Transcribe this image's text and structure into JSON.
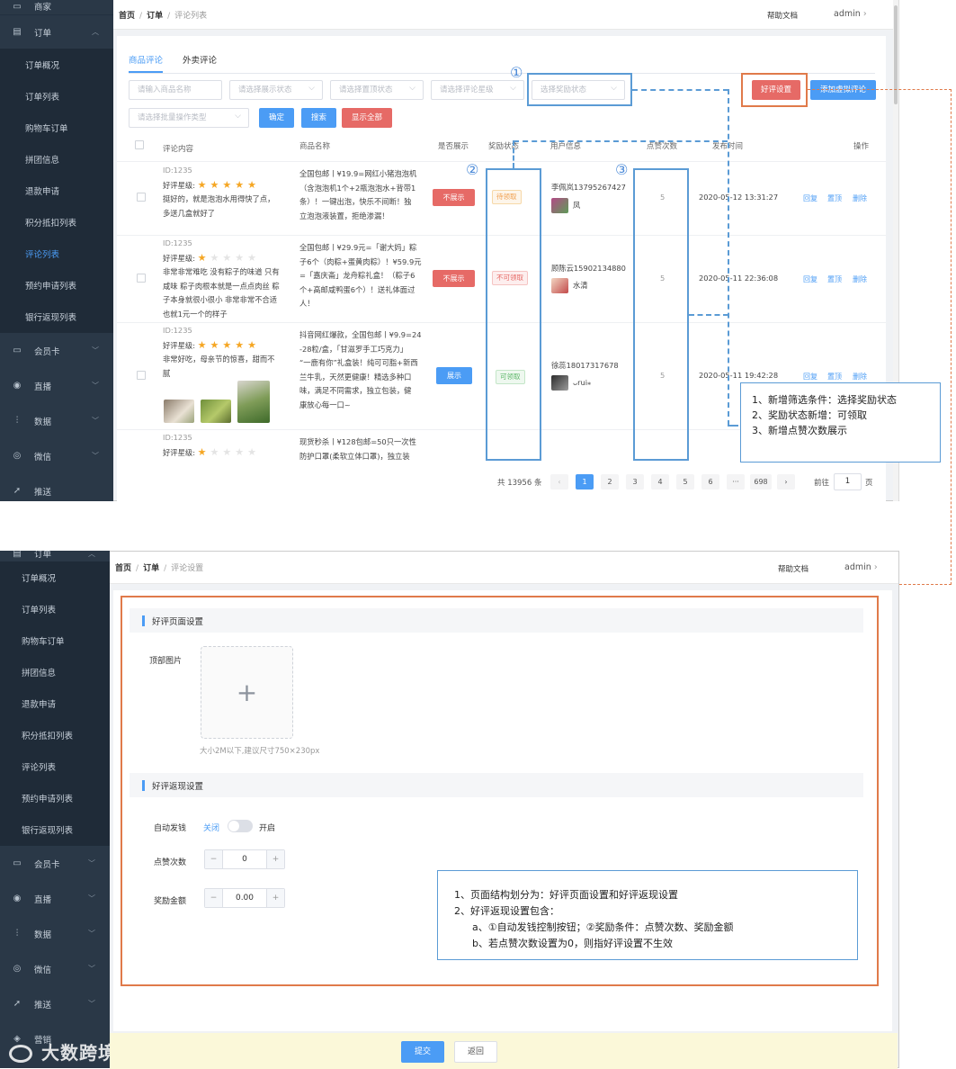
{
  "top": {
    "sidebar": {
      "items": [
        {
          "icon": "store-icon",
          "label": "商家",
          "type": "top"
        },
        {
          "icon": "order-icon",
          "label": "订单",
          "type": "top",
          "expanded": true
        },
        {
          "label": "订单概况",
          "type": "child"
        },
        {
          "label": "订单列表",
          "type": "child"
        },
        {
          "label": "购物车订单",
          "type": "child"
        },
        {
          "label": "拼团信息",
          "type": "child"
        },
        {
          "label": "退款申请",
          "type": "child"
        },
        {
          "label": "积分抵扣列表",
          "type": "child"
        },
        {
          "label": "评论列表",
          "type": "child",
          "active": true
        },
        {
          "label": "预约申请列表",
          "type": "child"
        },
        {
          "label": "银行返现列表",
          "type": "child"
        },
        {
          "icon": "card-icon",
          "label": "会员卡",
          "type": "top"
        },
        {
          "icon": "live-icon",
          "label": "直播",
          "type": "top"
        },
        {
          "icon": "data-icon",
          "label": "数据",
          "type": "top"
        },
        {
          "icon": "wechat-icon",
          "label": "微信",
          "type": "top"
        },
        {
          "icon": "push-icon",
          "label": "推送",
          "type": "top"
        }
      ]
    },
    "breadcrumb": {
      "home": "首页",
      "section": "订单",
      "current": "评论列表"
    },
    "help": "帮助文档",
    "admin": "admin",
    "tabs": [
      "商品评论",
      "外卖评论"
    ],
    "filters": {
      "product_name": "请输入商品名称",
      "display_status": "请选择展示状态",
      "top_status": "请选择置顶状态",
      "rating": "请选择评论星级",
      "reward_status": "选择奖励状态",
      "batch_type": "请选择批量操作类型"
    },
    "buttons": {
      "confirm": "确定",
      "search": "搜索",
      "show_all": "显示全部",
      "good_review_settings": "好评设置",
      "add_fake_review": "添加虚拟评论"
    },
    "table": {
      "headers": [
        "评论内容",
        "商品名称",
        "是否展示",
        "奖励状态",
        "用户信息",
        "点赞次数",
        "发布时间",
        "操作"
      ],
      "rows": [
        {
          "id": "ID:1235",
          "rating_label": "好评星级:",
          "stars": 5,
          "comment": [
            "挺好的，就是泡泡水用得快了点，",
            "多送几盒就好了"
          ],
          "product": [
            "全国包邮丨¥19.9=网红小猪泡泡机",
            "（含泡泡机1个+2瓶泡泡水+背带1",
            "条）！一键出泡，快乐不间断！独",
            "立泡泡液装置，拒绝渗漏！"
          ],
          "display_btn": "不展示",
          "reward": "待领取",
          "user_name": "李佩岚13795267427",
          "nickname": "凤",
          "likes": "5",
          "time": "2020-05-12 13:31:27",
          "actions": [
            "回复",
            "置顶",
            "删除"
          ]
        },
        {
          "id": "ID:1235",
          "rating_label": "好评星级:",
          "stars": 1,
          "comment": [
            "非常非常难吃 没有粽子的味道 只有",
            "咸味 粽子肉根本就是一点点肉丝 粽",
            "子本身就很小很小 非常非常不合适",
            "也就1元一个的样子"
          ],
          "product": [
            "全国包邮丨¥29.9元=「谢大妈」粽",
            "子6个（肉粽+蛋黄肉粽）！¥59.9元",
            "=「嘉庆斋」龙舟粽礼盒！（粽子6",
            "个+高邮咸鸭蛋6个）！送礼体面过",
            "人！"
          ],
          "display_btn": "不展示",
          "reward": "不可领取",
          "user_name": "顾陈云15902134880",
          "nickname": "水清",
          "likes": "5",
          "time": "2020-05-11 22:36:08",
          "actions": [
            "回复",
            "置顶",
            "删除"
          ]
        },
        {
          "id": "ID:1235",
          "rating_label": "好评星级:",
          "stars": 5,
          "comment": [
            "非常好吃，母亲节的惊喜，甜而不",
            "腻"
          ],
          "product": [
            "抖音网红爆款，全国包邮丨¥9.9=24",
            "-28粒/盒，「甘滋罗手工巧克力」",
            "“一鹿有你”礼盒装！纯可可脂+新西",
            "兰牛乳，天然更健康！精选多种口",
            "味，满足不同需求，独立包装，健",
            "康放心每一口~"
          ],
          "display_btn": "展示",
          "reward": "可领取",
          "user_name": "徐蕊18017317678",
          "nickname": "ᴗrui⁎",
          "likes": "5",
          "time": "2020-05-11 19:42:28",
          "actions": [
            "回复",
            "置顶",
            "删除"
          ]
        },
        {
          "id": "ID:1235",
          "rating_label": "好评星级:",
          "stars": 1,
          "comment": [],
          "product": [
            "现货秒杀丨¥128包邮=50只一次性",
            "防护口罩(柔软立体口罩)，独立装"
          ],
          "display_btn": "",
          "reward": "",
          "user_name": "",
          "nickname": "",
          "likes": "",
          "time": "",
          "actions": []
        }
      ]
    },
    "pagination": {
      "total": "共 13956 条",
      "pages": [
        "1",
        "2",
        "3",
        "4",
        "5",
        "6",
        "···",
        "698"
      ],
      "goto_label": "前往",
      "goto_value": "1",
      "page_unit": "页"
    },
    "annotations": {
      "markers": [
        "①",
        "②",
        "③"
      ],
      "note": [
        "1、新增筛选条件：选择奖励状态",
        "2、奖励状态新增：可领取",
        "3、新增点赞次数展示"
      ]
    }
  },
  "bottom": {
    "sidebar": {
      "items": [
        {
          "icon": "order-icon",
          "label": "订单",
          "type": "top",
          "expanded": true
        },
        {
          "label": "订单概况",
          "type": "child"
        },
        {
          "label": "订单列表",
          "type": "child"
        },
        {
          "label": "购物车订单",
          "type": "child"
        },
        {
          "label": "拼团信息",
          "type": "child"
        },
        {
          "label": "退款申请",
          "type": "child"
        },
        {
          "label": "积分抵扣列表",
          "type": "child"
        },
        {
          "label": "评论列表",
          "type": "child"
        },
        {
          "label": "预约申请列表",
          "type": "child"
        },
        {
          "label": "银行返现列表",
          "type": "child"
        },
        {
          "icon": "card-icon",
          "label": "会员卡",
          "type": "top"
        },
        {
          "icon": "live-icon",
          "label": "直播",
          "type": "top"
        },
        {
          "icon": "data-icon",
          "label": "数据",
          "type": "top"
        },
        {
          "icon": "wechat-icon",
          "label": "微信",
          "type": "top"
        },
        {
          "icon": "push-icon",
          "label": "推送",
          "type": "top"
        },
        {
          "icon": "marketing-icon",
          "label": "营销",
          "type": "top"
        }
      ]
    },
    "breadcrumb": {
      "home": "首页",
      "section": "订单",
      "current": "评论设置"
    },
    "help": "帮助文档",
    "admin": "admin",
    "section1": {
      "title": "好评页面设置",
      "top_image_label": "顶部图片",
      "upload_hint": "大小2M以下,建议尺寸750×230px"
    },
    "section2": {
      "title": "好评返现设置",
      "auto_pay_label": "自动发钱",
      "off_label": "关闭",
      "on_label": "开启",
      "likes_label": "点赞次数",
      "likes_value": "0",
      "amount_label": "奖励金额",
      "amount_value": "0.00"
    },
    "buttons": {
      "submit": "提交",
      "back": "返回"
    },
    "note": [
      "1、页面结构划分为：好评页面设置和好评返现设置",
      "2、好评返现设置包含：",
      "a、①自动发钱控制按钮；②奖励条件：点赞次数、奖励金额",
      "b、若点赞次数设置为0，则指好评设置不生效"
    ],
    "watermark": "大数跨境"
  },
  "colors": {
    "accent": "#4b9cf5",
    "danger": "#e66a66",
    "annotation_blue": "#5b9bd5",
    "annotation_orange": "#e07a4a",
    "sidebar_bg": "#2a3847"
  }
}
